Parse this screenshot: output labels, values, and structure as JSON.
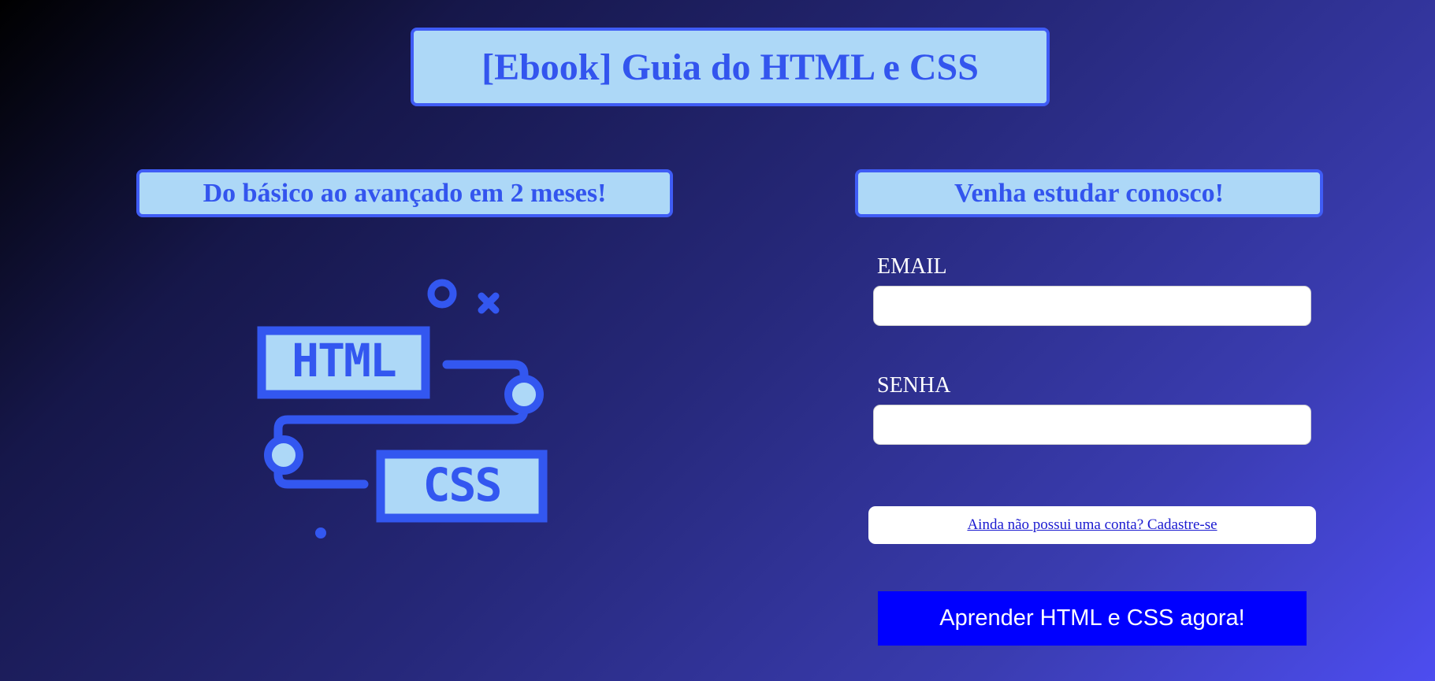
{
  "header": {
    "title": "[Ebook] Guia do HTML e CSS"
  },
  "left_panel": {
    "subtitle": "Do básico ao avançado em 2 meses!",
    "illustration": {
      "icon": "html-css-roadmap-icon",
      "html_label": "HTML",
      "css_label": "CSS"
    }
  },
  "right_panel": {
    "subtitle": "Venha estudar conosco!",
    "email_label": "EMAIL",
    "email_value": "",
    "password_label": "SENHA",
    "password_value": "",
    "signup_link": "Ainda não possui uma conta? Cadastre-se",
    "submit_button": "Aprender HTML e CSS agora!"
  },
  "colors": {
    "accent": "#3f5cf5",
    "box_fill": "#add8f7",
    "title_text": "#3355ee",
    "button": "#0000ff",
    "link": "#1a1ad0"
  }
}
